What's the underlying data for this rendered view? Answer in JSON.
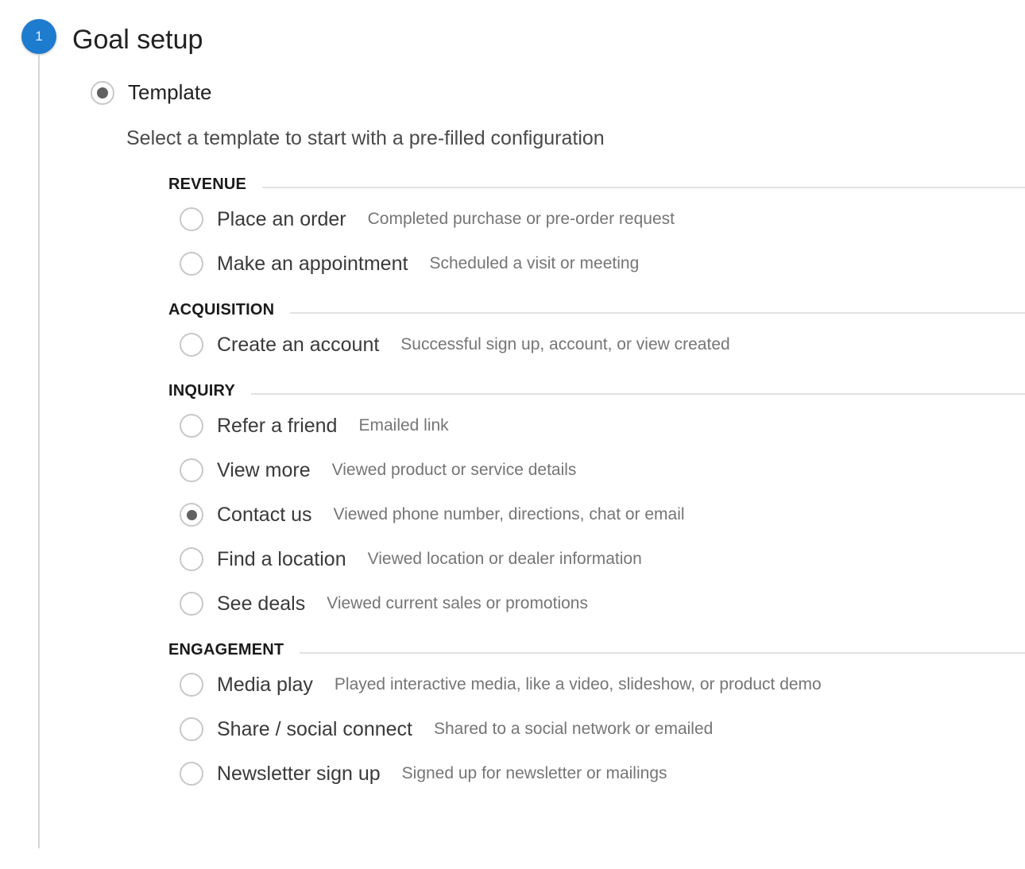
{
  "step": {
    "number": "1",
    "title": "Goal setup",
    "accent_color": "#1e7ccf"
  },
  "mode": {
    "label": "Template",
    "checked": true
  },
  "subtitle": "Select a template to start with a pre-filled configuration",
  "groups": [
    {
      "title": "REVENUE",
      "options": [
        {
          "label": "Place an order",
          "description": "Completed purchase or pre-order request",
          "checked": false
        },
        {
          "label": "Make an appointment",
          "description": "Scheduled a visit or meeting",
          "checked": false
        }
      ]
    },
    {
      "title": "ACQUISITION",
      "options": [
        {
          "label": "Create an account",
          "description": "Successful sign up, account, or view created",
          "checked": false
        }
      ]
    },
    {
      "title": "INQUIRY",
      "options": [
        {
          "label": "Refer a friend",
          "description": "Emailed link",
          "checked": false
        },
        {
          "label": "View more",
          "description": "Viewed product or service details",
          "checked": false
        },
        {
          "label": "Contact us",
          "description": "Viewed phone number, directions, chat or email",
          "checked": true
        },
        {
          "label": "Find a location",
          "description": "Viewed location or dealer information",
          "checked": false
        },
        {
          "label": "See deals",
          "description": "Viewed current sales or promotions",
          "checked": false
        }
      ]
    },
    {
      "title": "ENGAGEMENT",
      "options": [
        {
          "label": "Media play",
          "description": "Played interactive media, like a video, slideshow, or product demo",
          "checked": false
        },
        {
          "label": "Share / social connect",
          "description": "Shared to a social network or emailed",
          "checked": false
        },
        {
          "label": "Newsletter sign up",
          "description": "Signed up for newsletter or mailings",
          "checked": false
        }
      ]
    }
  ]
}
